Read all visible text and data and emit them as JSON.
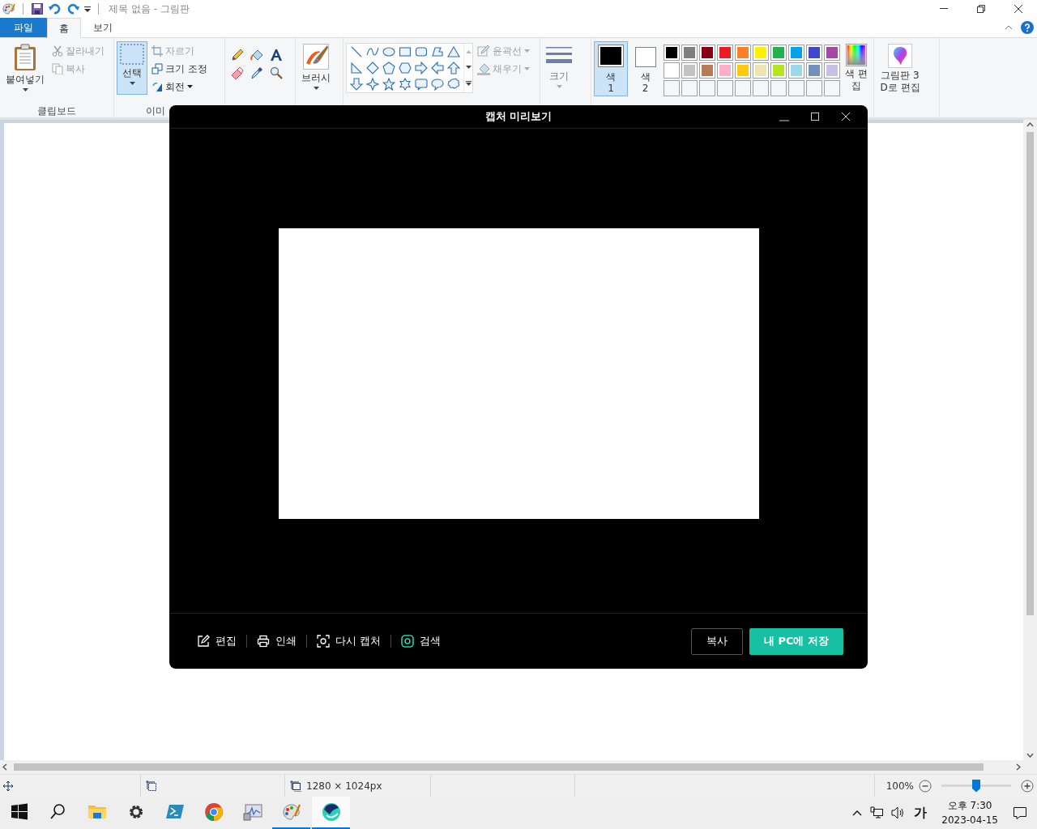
{
  "window": {
    "title": "제목 없음 - 그림판"
  },
  "ribbon": {
    "tabs": [
      {
        "label": "파일",
        "kind": "file",
        "selected": false
      },
      {
        "label": "홈",
        "kind": "tab",
        "selected": true
      },
      {
        "label": "보기",
        "kind": "tab",
        "selected": false
      }
    ],
    "clipboard": {
      "label": "클립보드",
      "paste": {
        "label": "붙여넣기"
      },
      "cut": {
        "label": "잘라내기",
        "disabled": true
      },
      "copy": {
        "label": "복사",
        "disabled": true
      }
    },
    "image": {
      "label": "이미",
      "select": {
        "label": "선택",
        "selected": true
      },
      "crop": {
        "label": "자르기",
        "disabled": true
      },
      "resize": {
        "label": "크기 조정",
        "disabled": false
      },
      "rotate": {
        "label": "회전",
        "disabled": false
      }
    },
    "brushes": {
      "label": "브러시"
    },
    "shapes": {
      "outline": {
        "label": "윤곽선",
        "disabled": true
      },
      "fill": {
        "label": "채우기",
        "disabled": true
      }
    },
    "size": {
      "label": "크기"
    },
    "colors": {
      "current": [
        {
          "label": "색",
          "number": "1",
          "color": "#000000",
          "selected": true
        },
        {
          "label": "색",
          "number": "2",
          "color": "#ffffff",
          "selected": false
        }
      ],
      "palette": [
        {
          "color": "#000000"
        },
        {
          "color": "#7f7f7f"
        },
        {
          "color": "#880015"
        },
        {
          "color": "#ed1c24"
        },
        {
          "color": "#ff7f27"
        },
        {
          "color": "#fff200"
        },
        {
          "color": "#22b14c"
        },
        {
          "color": "#00a2e8"
        },
        {
          "color": "#3f48cc"
        },
        {
          "color": "#a349a4"
        },
        {
          "color": "#ffffff"
        },
        {
          "color": "#c3c3c3"
        },
        {
          "color": "#b97a57"
        },
        {
          "color": "#ffaec9"
        },
        {
          "color": "#ffc90e"
        },
        {
          "color": "#efe4b0"
        },
        {
          "color": "#b5e61d"
        },
        {
          "color": "#99d9ea"
        },
        {
          "color": "#7092be"
        },
        {
          "color": "#c8bfe7"
        },
        {
          "kind": "empty"
        },
        {
          "kind": "empty"
        },
        {
          "kind": "empty"
        },
        {
          "kind": "empty"
        },
        {
          "kind": "empty"
        },
        {
          "kind": "empty"
        },
        {
          "kind": "empty"
        },
        {
          "kind": "empty"
        },
        {
          "kind": "empty"
        },
        {
          "kind": "empty"
        }
      ],
      "edit": {
        "label": "색 편집"
      }
    },
    "paint3d": {
      "label": "그림판 3D로 편집"
    }
  },
  "status_bar": {
    "size": "1280 × 1024px",
    "zoom": "100%",
    "zoom_slider": {
      "level": 0.5
    }
  },
  "dialog": {
    "title": "캡처 미리보기",
    "actions": [
      {
        "kind": "edit",
        "label": "편집"
      },
      {
        "kind": "print",
        "label": "인쇄"
      },
      {
        "kind": "recapture",
        "label": "다시 캡처"
      },
      {
        "kind": "search",
        "label": "검색"
      }
    ],
    "buttons": [
      {
        "kind": "secondary",
        "label": "복사"
      },
      {
        "kind": "primary",
        "label": "내 PC에 저장"
      }
    ]
  },
  "taskbar": {
    "apps": [
      {
        "kind": "start",
        "running": false,
        "selected": false
      },
      {
        "kind": "search",
        "running": false,
        "selected": false
      },
      {
        "kind": "explorer",
        "running": false,
        "selected": false
      },
      {
        "kind": "settings",
        "running": false,
        "selected": false
      },
      {
        "kind": "powershell",
        "running": false,
        "selected": false
      },
      {
        "kind": "chrome",
        "running": false,
        "selected": false
      },
      {
        "kind": "monitor",
        "running": false,
        "selected": false
      },
      {
        "kind": "paint",
        "running": true,
        "selected": false
      },
      {
        "kind": "whale",
        "running": true,
        "selected": true
      }
    ],
    "tray": {
      "ime": "가",
      "time": "오후 7:30",
      "date": "2023-04-15"
    }
  }
}
